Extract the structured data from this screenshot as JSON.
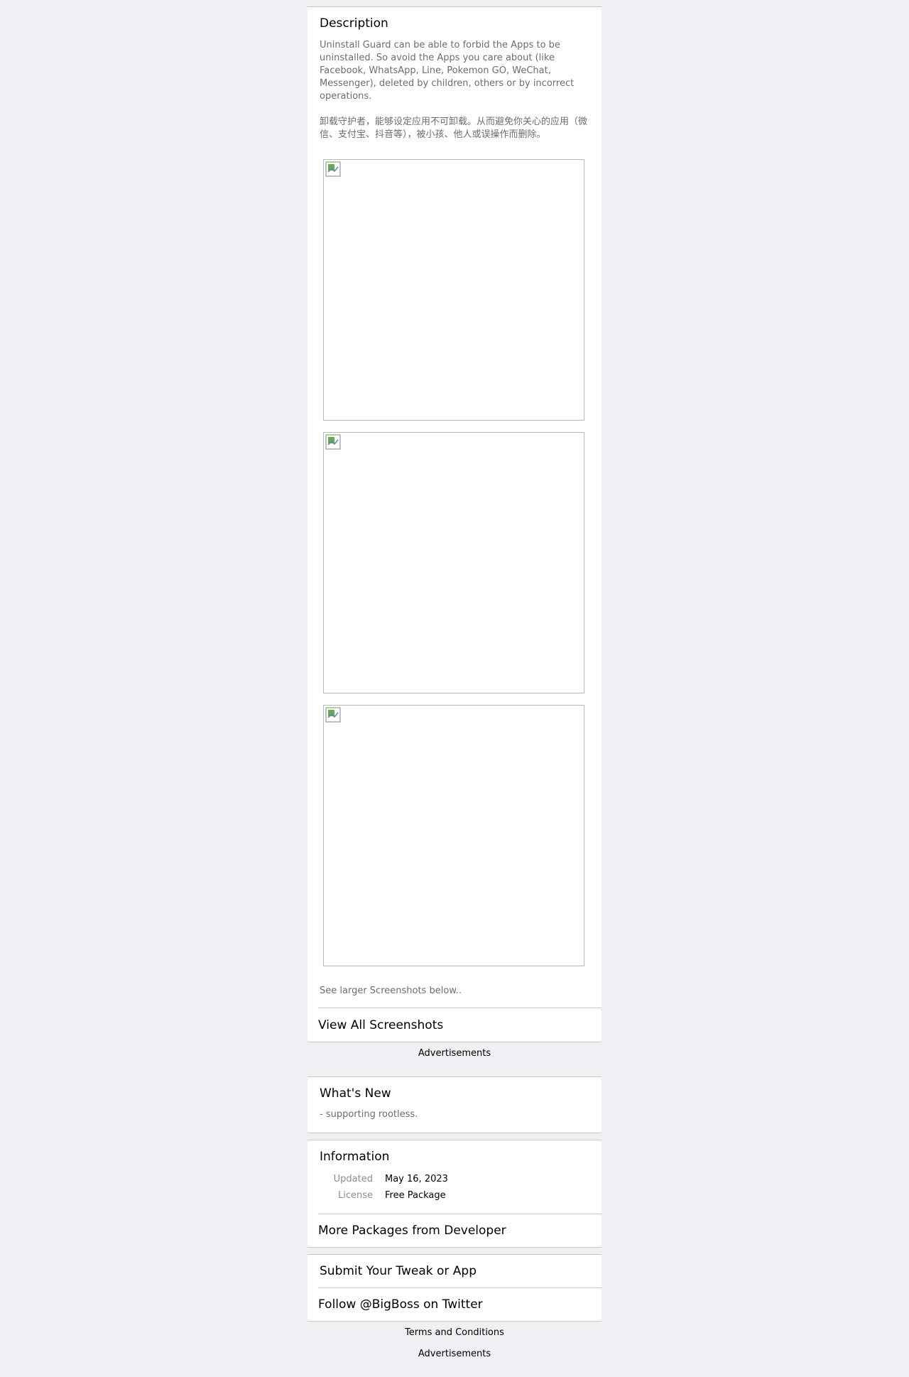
{
  "description": {
    "title": "Description",
    "text_en": "Uninstall Guard can be able to forbid the Apps to be uninstalled. So avoid the Apps you care about (like Facebook, WhatsApp, Line, Pokemon GO, WeChat, Messenger), deleted by children, others or by incorrect operations.",
    "text_zh": "卸载守护者，能够设定应用不可卸载。从而避免你关心的应用（微信、支付宝、抖音等），被小孩、他人或误操作而删除。",
    "screenshot_icon": "broken-image-icon",
    "see_larger": "See larger Screenshots below..",
    "view_all": "View All Screenshots"
  },
  "ads_label_1": "Advertisements",
  "whats_new": {
    "title": "What's New",
    "text": "- supporting rootless."
  },
  "information": {
    "title": "Information",
    "rows": [
      {
        "key": "Updated",
        "value": "May 16, 2023"
      },
      {
        "key": "License",
        "value": "Free Package"
      }
    ],
    "more_packages": "More Packages from Developer"
  },
  "links": {
    "submit": "Submit Your Tweak or App",
    "follow": "Follow @BigBoss on Twitter"
  },
  "footer": {
    "terms": "Terms and Conditions",
    "ads_label_2": "Advertisements"
  }
}
